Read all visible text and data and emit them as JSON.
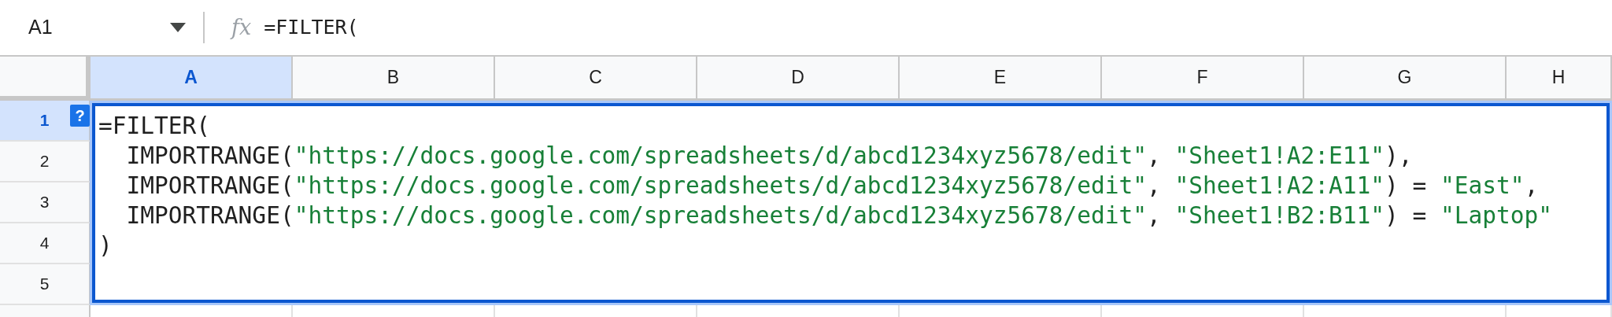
{
  "name_box": {
    "value": "A1"
  },
  "formula_bar": {
    "icon": "fx",
    "value": "=FILTER("
  },
  "columns": [
    {
      "label": "A",
      "selected": true
    },
    {
      "label": "B",
      "selected": false
    },
    {
      "label": "C",
      "selected": false
    },
    {
      "label": "D",
      "selected": false
    },
    {
      "label": "E",
      "selected": false
    },
    {
      "label": "F",
      "selected": false
    },
    {
      "label": "G",
      "selected": false
    },
    {
      "label": "H",
      "selected": false
    }
  ],
  "rows": [
    {
      "label": "1",
      "selected": true
    },
    {
      "label": "2",
      "selected": false
    },
    {
      "label": "3",
      "selected": false
    },
    {
      "label": "4",
      "selected": false
    },
    {
      "label": "5",
      "selected": false
    }
  ],
  "editor": {
    "help_badge": "?",
    "lines": [
      [
        {
          "kind": "code",
          "text": "=FILTER("
        }
      ],
      [
        {
          "kind": "code",
          "text": "  IMPORTRANGE("
        },
        {
          "kind": "string",
          "text": "\"https://docs.google.com/spreadsheets/d/abcd1234xyz5678/edit\""
        },
        {
          "kind": "code",
          "text": ", "
        },
        {
          "kind": "string",
          "text": "\"Sheet1!A2:E11\""
        },
        {
          "kind": "code",
          "text": "),"
        }
      ],
      [
        {
          "kind": "code",
          "text": "  IMPORTRANGE("
        },
        {
          "kind": "string",
          "text": "\"https://docs.google.com/spreadsheets/d/abcd1234xyz5678/edit\""
        },
        {
          "kind": "code",
          "text": ", "
        },
        {
          "kind": "string",
          "text": "\"Sheet1!A2:A11\""
        },
        {
          "kind": "code",
          "text": ") = "
        },
        {
          "kind": "string",
          "text": "\"East\""
        },
        {
          "kind": "code",
          "text": ","
        }
      ],
      [
        {
          "kind": "code",
          "text": "  IMPORTRANGE("
        },
        {
          "kind": "string",
          "text": "\"https://docs.google.com/spreadsheets/d/abcd1234xyz5678/edit\""
        },
        {
          "kind": "code",
          "text": ", "
        },
        {
          "kind": "string",
          "text": "\"Sheet1!B2:B11\""
        },
        {
          "kind": "code",
          "text": ") = "
        },
        {
          "kind": "string",
          "text": "\"Laptop\""
        }
      ],
      [
        {
          "kind": "code",
          "text": ")"
        }
      ]
    ]
  }
}
